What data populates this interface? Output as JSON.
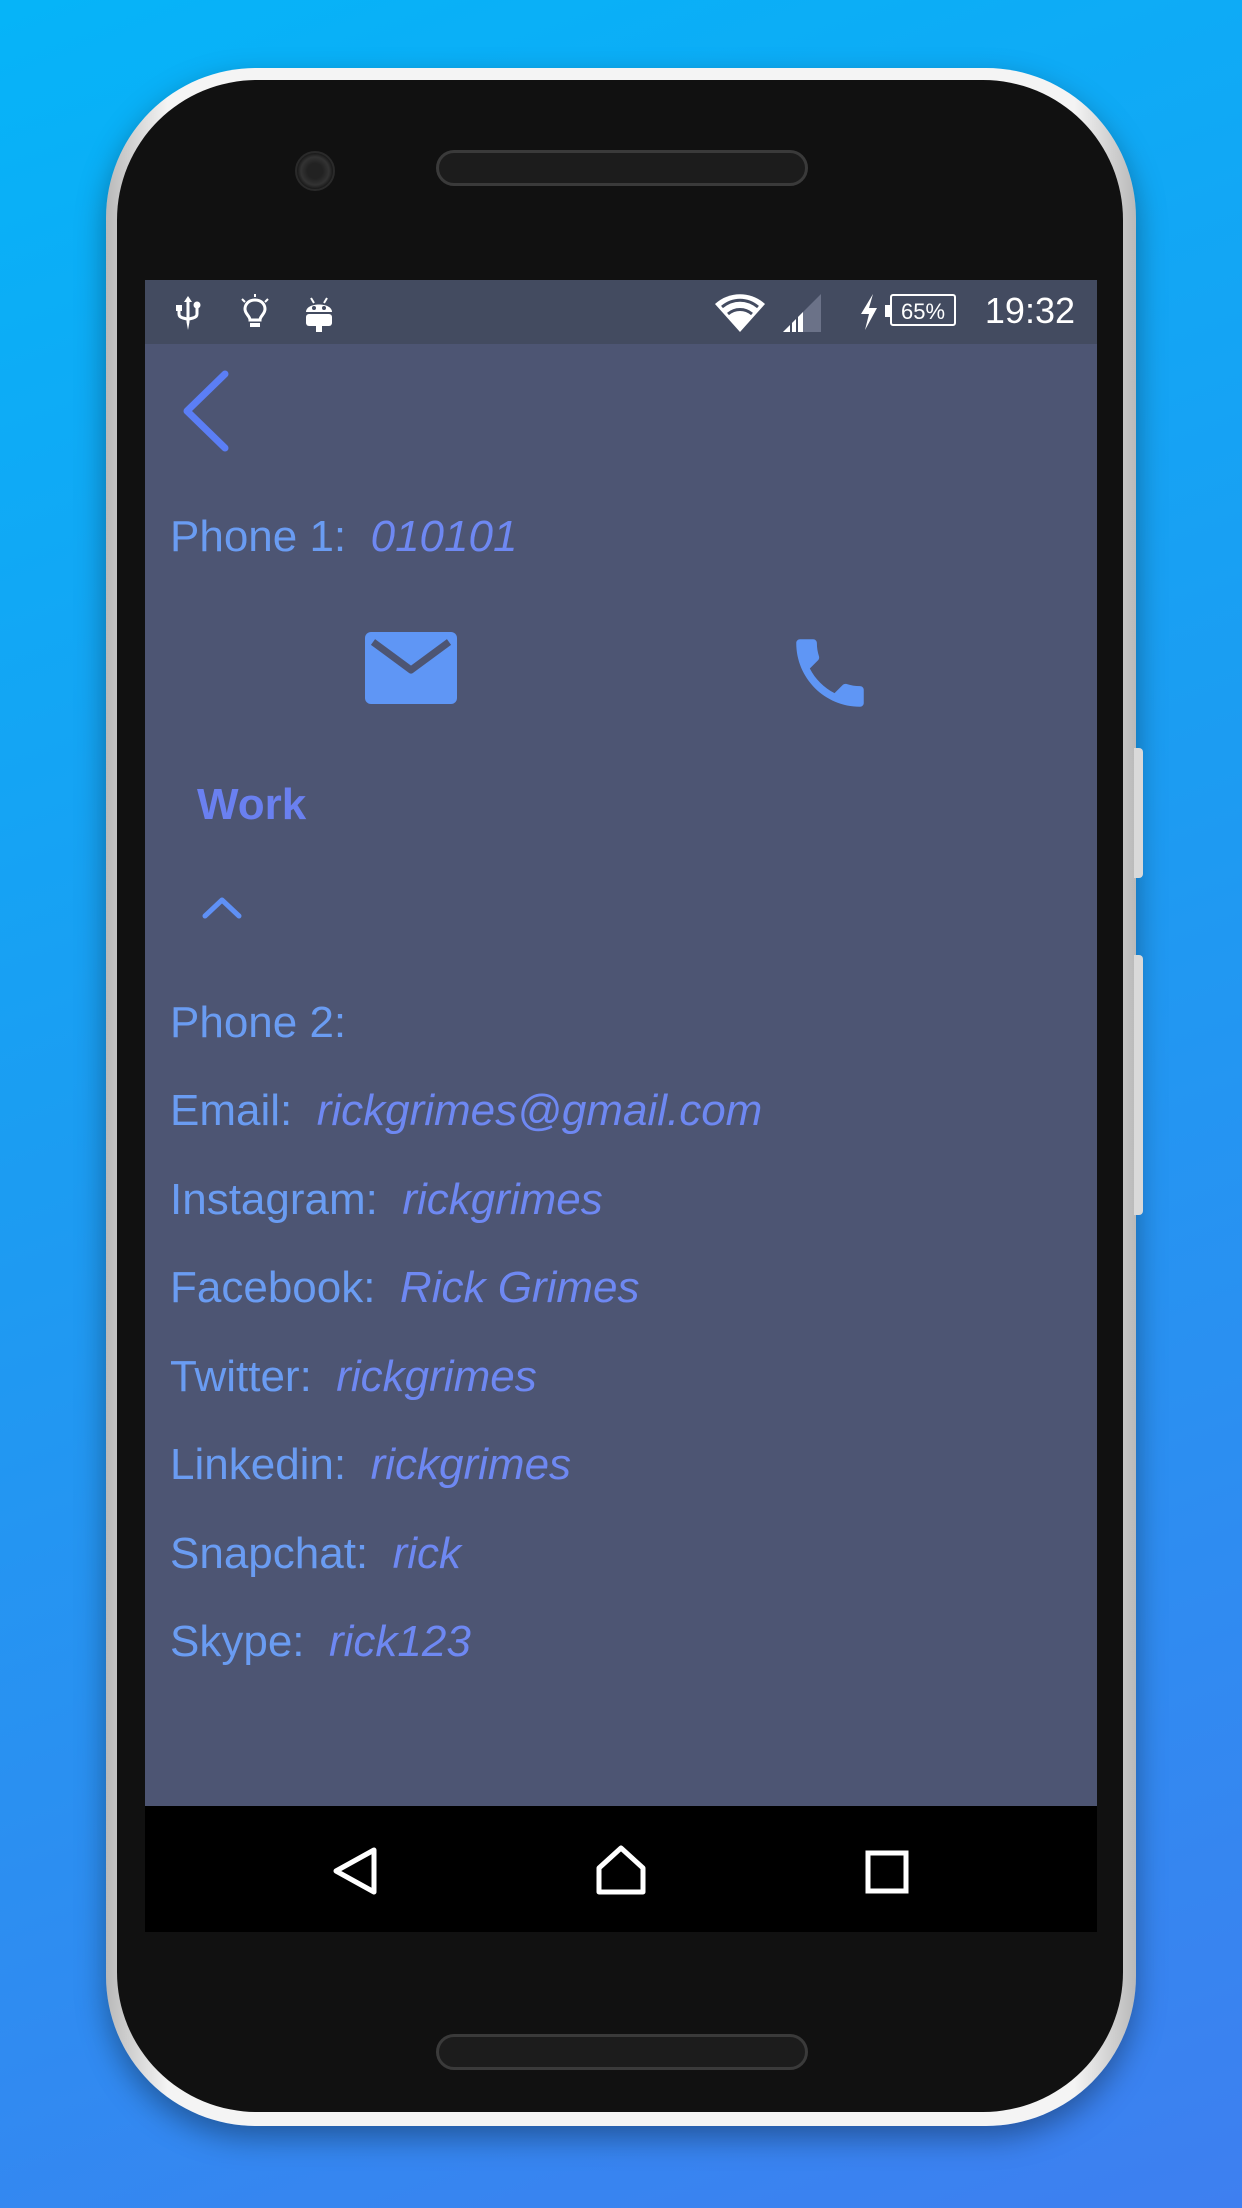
{
  "status_bar": {
    "time": "19:32",
    "battery": "65%",
    "left_icons": [
      "usb-icon",
      "lightbulb-icon",
      "android-icon"
    ],
    "right_icons": [
      "wifi-icon",
      "signal-icon",
      "charging-icon"
    ]
  },
  "contact": {
    "phone1": {
      "label": "Phone 1:",
      "value": "010101"
    },
    "section_title": "Work",
    "fields": [
      {
        "label": "Phone 2:",
        "value": ""
      },
      {
        "label": "Email:",
        "value": "rickgrimes@gmail.com"
      },
      {
        "label": "Instagram:",
        "value": "rickgrimes"
      },
      {
        "label": "Facebook:",
        "value": "Rick Grimes"
      },
      {
        "label": "Twitter:",
        "value": "rickgrimes"
      },
      {
        "label": "Linkedin:",
        "value": "rickgrimes"
      },
      {
        "label": "Snapchat:",
        "value": "rick"
      },
      {
        "label": "Skype:",
        "value": "rick123"
      }
    ]
  },
  "colors": {
    "background": "#4d5573",
    "status_bar": "#434b60",
    "label": "#6a9cf2",
    "value": "#6e88f2",
    "accent": "#5b8ef5"
  }
}
